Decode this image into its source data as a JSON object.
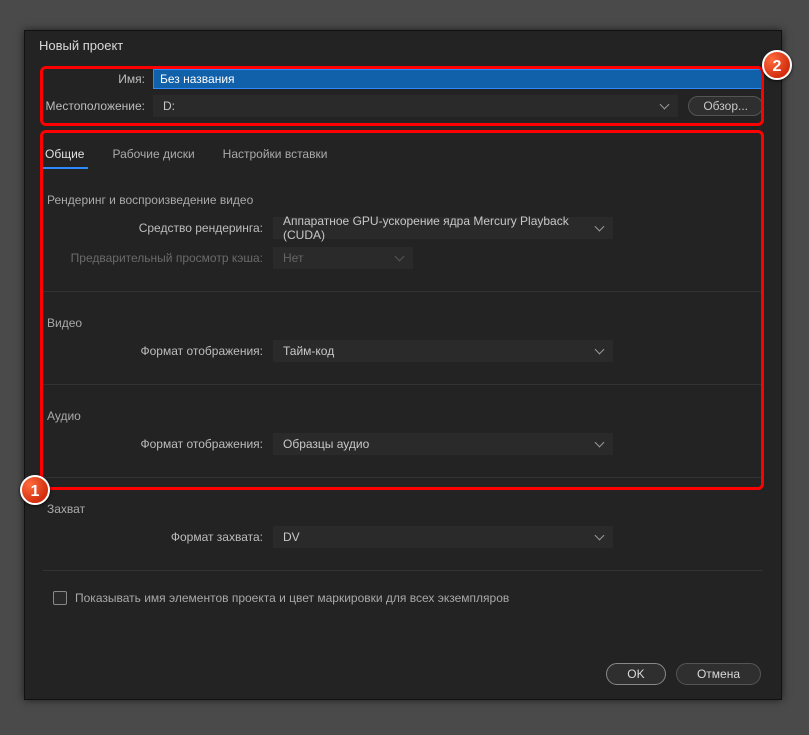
{
  "dialog_title": "Новый проект",
  "name_label": "Имя:",
  "name_value": "Без названия",
  "location_label": "Местоположение:",
  "location_value": "D:",
  "browse_label": "Обзор...",
  "tabs": {
    "general": "Общие",
    "scratch_disks": "Рабочие диски",
    "ingest_settings": "Настройки вставки"
  },
  "rendering": {
    "title": "Рендеринг и воспроизведение видео",
    "renderer_label": "Средство рендеринга:",
    "renderer_value": "Аппаратное GPU-ускорение ядра Mercury Playback (CUDA)",
    "preview_cache_label": "Предварительный просмотр кэша:",
    "preview_cache_value": "Нет"
  },
  "video": {
    "title": "Видео",
    "display_format_label": "Формат отображения:",
    "display_format_value": "Тайм-код"
  },
  "audio": {
    "title": "Аудио",
    "display_format_label": "Формат отображения:",
    "display_format_value": "Образцы аудио"
  },
  "capture": {
    "title": "Захват",
    "capture_format_label": "Формат захвата:",
    "capture_format_value": "DV"
  },
  "checkbox_label": "Показывать имя элементов проекта и цвет маркировки для всех экземпляров",
  "footer": {
    "ok": "OK",
    "cancel": "Отмена"
  },
  "badges": {
    "one": "1",
    "two": "2"
  }
}
